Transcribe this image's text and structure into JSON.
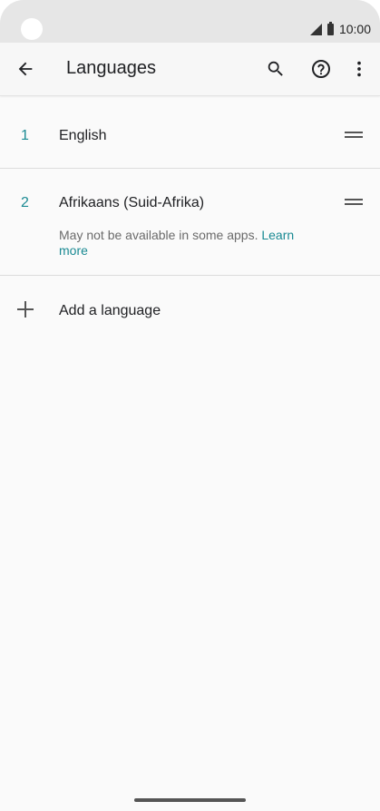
{
  "status_bar": {
    "time": "10:00",
    "icons": [
      "signal-icon",
      "battery-icon"
    ]
  },
  "app_bar": {
    "title": "Languages",
    "icons": [
      "back-arrow-icon",
      "search-icon",
      "help-icon",
      "more-vert-icon"
    ]
  },
  "languages": [
    {
      "number": "1",
      "name": "English"
    },
    {
      "number": "2",
      "name": "Afrikaans (Suid-Afrika)",
      "note": "May not be available in some apps.",
      "link": "Learn more"
    }
  ],
  "add_language": {
    "label": "Add a language",
    "icon": "plus-icon"
  },
  "colors": {
    "accent": "#1a8a93",
    "background": "#fafafa",
    "status_bar": "#e6e6e6"
  }
}
